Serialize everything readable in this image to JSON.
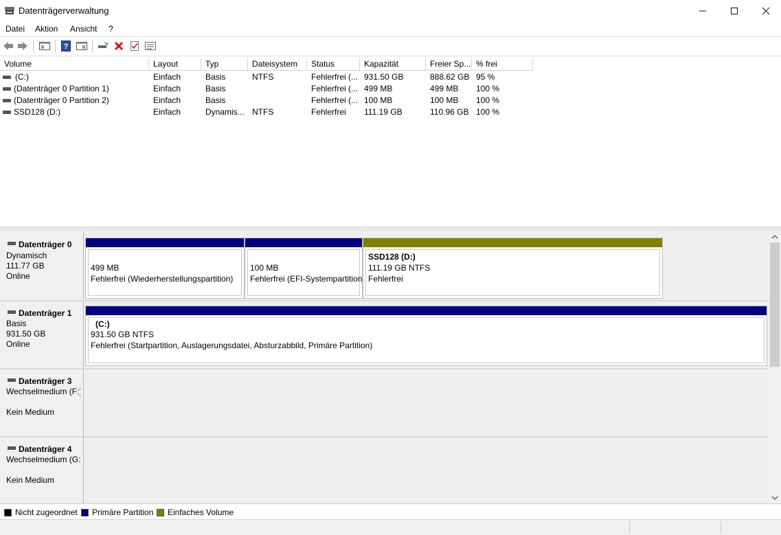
{
  "window": {
    "title": "Datenträgerverwaltung",
    "minimize_icon": "minimize-icon",
    "maximize_icon": "maximize-icon",
    "close_icon": "close-icon"
  },
  "menu": [
    "Datei",
    "Aktion",
    "Ansicht",
    "?"
  ],
  "toolbar": [
    "back-icon",
    "forward-icon",
    "console-tree-icon",
    "help-icon",
    "properties-panel-icon",
    "connect-disk-icon",
    "delete-icon",
    "check-icon",
    "settings-list-icon"
  ],
  "list": {
    "columns": [
      "Volume",
      "Layout",
      "Typ",
      "Dateisystem",
      "Status",
      "Kapazität",
      "Freier Sp...",
      "% frei"
    ],
    "rows": [
      [
        "(C:)",
        "Einfach",
        "Basis",
        "NTFS",
        "Fehlerfrei (...",
        "931.50 GB",
        "888.62 GB",
        "95 %"
      ],
      [
        "(Datenträger 0 Partition 1)",
        "Einfach",
        "Basis",
        "",
        "Fehlerfrei (...",
        "499 MB",
        "499 MB",
        "100 %"
      ],
      [
        "(Datenträger 0 Partition 2)",
        "Einfach",
        "Basis",
        "",
        "Fehlerfrei (...",
        "100 MB",
        "100 MB",
        "100 %"
      ],
      [
        "SSD128 (D:)",
        "Einfach",
        "Dynamis...",
        "NTFS",
        "Fehlerfrei",
        "111.19 GB",
        "110.96 GB",
        "100 %"
      ]
    ]
  },
  "disks": [
    {
      "name": "Datenträger 0",
      "type": "Dynamisch",
      "size": "111.77 GB",
      "state": "Online",
      "partitions": [
        {
          "title": "",
          "line1": "499 MB",
          "line2": "Fehlerfrei (Wiederherstellungspartition)",
          "color": "#00007f"
        },
        {
          "title": "",
          "line1": "100 MB",
          "line2": "Fehlerfrei (EFI-Systempartition)",
          "color": "#00007f"
        },
        {
          "title": "SSD128  (D:)",
          "line1": "111.19 GB NTFS",
          "line2": "Fehlerfrei",
          "color": "#808000"
        }
      ]
    },
    {
      "name": "Datenträger 1",
      "type": "Basis",
      "size": "931.50 GB",
      "state": "Online",
      "partitions": [
        {
          "title": "(C:)",
          "line1": "931.50 GB NTFS",
          "line2": "Fehlerfrei (Startpartition, Auslagerungsdatei, Absturzabbild, Primäre Partition)",
          "color": "#00007f"
        }
      ]
    },
    {
      "name": "Datenträger 3",
      "type": "Wechselmedium (F:)",
      "state": "Kein Medium"
    },
    {
      "name": "Datenträger 4",
      "type": "Wechselmedium (G:)",
      "state": "Kein Medium"
    }
  ],
  "legend": [
    {
      "label": "Nicht zugeordnet",
      "color": "#000000"
    },
    {
      "label": "Primäre Partition",
      "color": "#00007f"
    },
    {
      "label": "Einfaches Volume",
      "color": "#808000"
    }
  ]
}
